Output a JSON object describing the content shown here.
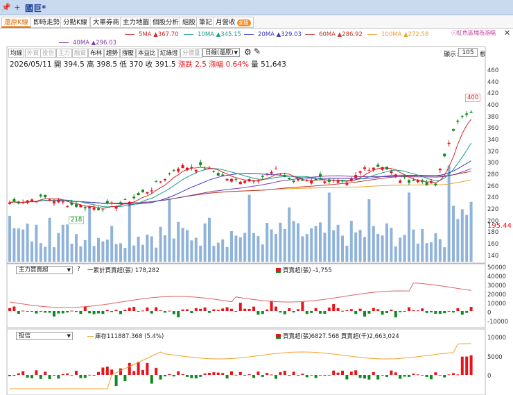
{
  "window": {
    "title": "國巨*",
    "pin": "📌",
    "plus": "+"
  },
  "tabs": [
    {
      "label": "還原K線",
      "active": true
    },
    {
      "label": "即時走勢"
    },
    {
      "label": "分點K線"
    },
    {
      "label": "大單券商"
    },
    {
      "label": "主力地圖"
    },
    {
      "label": "個股分析"
    },
    {
      "label": "組股"
    },
    {
      "label": "筆記"
    },
    {
      "label": "月營收",
      "badge": "新版"
    }
  ],
  "ma_legend": [
    {
      "label": "5MA ▲367.70",
      "color": "#d62728"
    },
    {
      "label": "10MA ▲345.15",
      "color": "#1a9a8a"
    },
    {
      "label": "20MA ▲329.03",
      "color": "#3a3ac0"
    },
    {
      "label": "60MA ▲286.92",
      "color": "#c0392b"
    },
    {
      "label": "100MA ▲272.58",
      "color": "#f0a030"
    },
    {
      "label": "40MA ▲296.03",
      "color": "#7b3fa0"
    }
  ],
  "hint": "紅色區塊為漲幅",
  "toolbar": {
    "buttons": [
      "均線",
      "外資",
      "投信",
      "主力",
      "融資",
      "布林",
      "趨勢",
      "撐壓",
      "本益比",
      "紅綠燈",
      "分價量"
    ],
    "period": "日線(還原)",
    "zoom_label": "顯示:",
    "zoom_value": "105",
    "zoom_unit": "根"
  },
  "quote": {
    "date": "2026/05/11",
    "open_label": "開",
    "open": "394.5",
    "high_label": "高",
    "high": "398.5",
    "low_label": "低",
    "low": "370",
    "close_label": "收",
    "close": "391.5",
    "chg_label": "漲跌",
    "chg": "2.5",
    "pct_label": "漲幅",
    "pct": "0.64%",
    "vol_label": "量",
    "vol": "51,643"
  },
  "price_axis": [
    "460",
    "440",
    "420",
    "400",
    "380",
    "360",
    "340",
    "320",
    "300",
    "280",
    "260",
    "240",
    "220",
    "200",
    "180",
    "160",
    "140"
  ],
  "labels": {
    "high_tag": "400",
    "low_tag": "218",
    "vol_tag": "195.44"
  },
  "panel1": {
    "selector": "主力買賣超",
    "cum_label": "一累計買賣超(張) 178,282",
    "net_label": "買賣超(張) -1,755",
    "axis": [
      "50000",
      "40000",
      "30000",
      "20000",
      "10000",
      "0",
      "-10000"
    ]
  },
  "panel2": {
    "selector": "投信",
    "hold_label": "庫存111887.368 (5.4%)",
    "net_label": "買賣超(張)6827.568 買賣超(千)2,663,024",
    "axis": [
      "10000",
      "5000",
      "0"
    ]
  },
  "colors": {
    "up": "#e8141c",
    "down": "#0f8a20",
    "volume": "#8fb3d9"
  },
  "chart_data": {
    "type": "candlestick",
    "period": "日線(還原)",
    "price_range": [
      130,
      470
    ],
    "last_close": 391.5,
    "n_bars": 105
  }
}
